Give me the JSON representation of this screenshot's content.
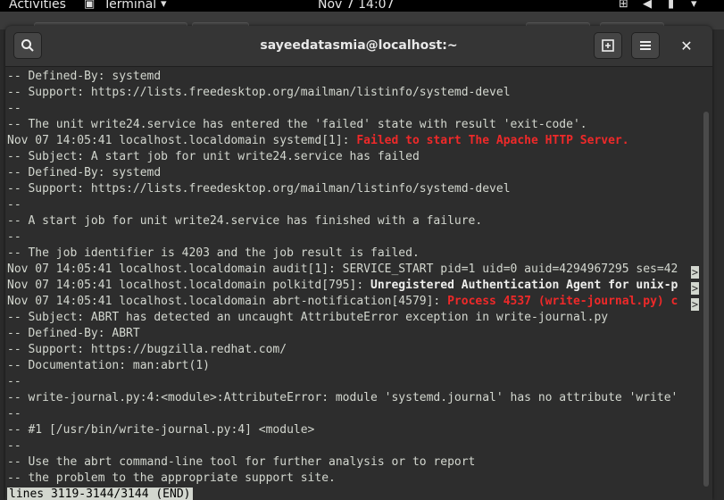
{
  "topbar": {
    "activities": "Activities",
    "app_menu": "Terminal",
    "clock": "Nov 7  14:07"
  },
  "window": {
    "title": "sayeedatasmia@localhost:~"
  },
  "terminal": {
    "lines": [
      {
        "text": "-- Defined-By: systemd"
      },
      {
        "text": "-- Support: https://lists.freedesktop.org/mailman/listinfo/systemd-devel"
      },
      {
        "text": "--"
      },
      {
        "text": "-- The unit write24.service has entered the 'failed' state with result 'exit-code'."
      },
      {
        "text": "Nov 07 14:05:41 localhost.localdomain systemd[1]: ",
        "red": "Failed to start The Apache HTTP Server."
      },
      {
        "text": "-- Subject: A start job for unit write24.service has failed"
      },
      {
        "text": "-- Defined-By: systemd"
      },
      {
        "text": "-- Support: https://lists.freedesktop.org/mailman/listinfo/systemd-devel"
      },
      {
        "text": "--"
      },
      {
        "text": "-- A start job for unit write24.service has finished with a failure."
      },
      {
        "text": "--"
      },
      {
        "text": "-- The job identifier is 4203 and the job result is failed."
      },
      {
        "text": "Nov 07 14:05:41 localhost.localdomain audit[1]: SERVICE_START pid=1 uid=0 auid=4294967295 ses=42"
      },
      {
        "text": "Nov 07 14:05:41 localhost.localdomain polkitd[795]: ",
        "bold": "Unregistered Authentication Agent for unix-p"
      },
      {
        "text": "Nov 07 14:05:41 localhost.localdomain abrt-notification[4579]: ",
        "red": "Process 4537 (write-journal.py) c"
      },
      {
        "text": "-- Subject: ABRT has detected an uncaught AttributeError exception in write-journal.py"
      },
      {
        "text": "-- Defined-By: ABRT"
      },
      {
        "text": "-- Support: https://bugzilla.redhat.com/"
      },
      {
        "text": "-- Documentation: man:abrt(1)"
      },
      {
        "text": "--"
      },
      {
        "text": "-- write-journal.py:4:<module>:AttributeError: module 'systemd.journal' has no attribute 'write'"
      },
      {
        "text": "--"
      },
      {
        "text": "-- #1 [/usr/bin/write-journal.py:4] <module>"
      },
      {
        "text": "--"
      },
      {
        "text": "-- Use the abrt command-line tool for further analysis or to report"
      },
      {
        "text": "-- the problem to the appropriate support site."
      }
    ],
    "truncation_marker": ">",
    "status_line": "lines 3119-3144/3144 (END)"
  },
  "icons": {
    "search": "search-icon",
    "new_tab": "new-tab-icon",
    "menu": "hamburger-menu-icon",
    "close": "close-icon"
  },
  "colors": {
    "error_red": "#ef2929",
    "terminal_bg": "#2d2d2d",
    "terminal_fg": "#d3d7cf"
  }
}
